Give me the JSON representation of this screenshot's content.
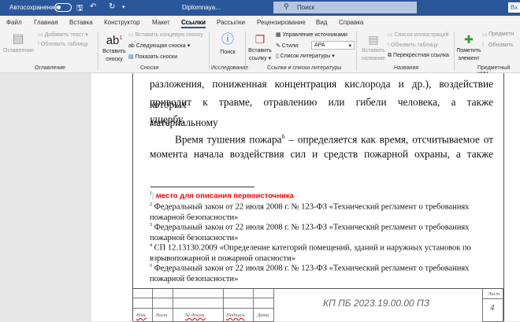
{
  "titlebar": {
    "autosave": "Автосохранение",
    "doc_name": "Diplomnaya...",
    "search_placeholder": "Поиск",
    "signin": "Вх"
  },
  "tabs": [
    "Файл",
    "Главная",
    "Вставка",
    "Конструктор",
    "Макет",
    "Ссылки",
    "Рассылки",
    "Рецензирование",
    "Вид",
    "Справка"
  ],
  "active_tab": "Ссылки",
  "ribbon": {
    "toc": {
      "big": "Оглавление",
      "add_text": "Добавить текст",
      "update_table": "Обновить таблицу",
      "group": "Оглавление"
    },
    "footnotes": {
      "insert_line1": "Вставить",
      "insert_line2": "сноску",
      "insert_endnote": "Вставить концевую сноску",
      "next_footnote": "Следующая сноска",
      "show_notes": "Показать сноски",
      "group": "Сноски"
    },
    "research": {
      "search": "Поиск",
      "group": "Исследование"
    },
    "citations": {
      "insert_line1": "Вставить",
      "insert_line2": "ссылку",
      "manage_sources": "Управление источниками",
      "style_label": "Стили:",
      "style_value": "APA",
      "bibliography": "Список литературы",
      "group": "Ссылки и списки литературы"
    },
    "captions": {
      "insert_line1": "Вставить",
      "insert_line2": "название",
      "table_of_figures": "Список иллюстраций",
      "update_table": "Обновить таблицу",
      "cross_ref": "Перекрестная ссылка",
      "group": "Названия"
    },
    "index": {
      "mark_line1": "Пометить",
      "mark_line2": "элемент",
      "insert_index": "Предметн",
      "update_index": "Обновить",
      "group": "Предметный указ"
    }
  },
  "document": {
    "p1": [
      "разложения, пониженная концентрация кислорода и др.), воздействие которых",
      "приводит к травме, отравлению или гибели человека, а также материальному",
      "ущербу."
    ],
    "p2_start": "Время тушения пожара",
    "p2_sup": "6",
    "p2_rest": " – определяется как время, отсчитываемое от",
    "p2_line2": "момента начала воздействия сил и средств пожарной охраны, а также",
    "footnotes": [
      {
        "num": "1",
        "text": "место для описания первоисточника",
        "highlight": "#e00000"
      },
      {
        "num": "2",
        "text": "Федеральный закон от 22 июля 2008 г. № 123-ФЗ «Технический регламент о требованиях пожарной безопасности»"
      },
      {
        "num": "3",
        "text": "Федеральный закон от 22 июля 2008 г.  № 123-ФЗ «Технический регламент о требованиях пожарной безопасности»"
      },
      {
        "num": "4",
        "text": "СП 12.13130.2009 «Определение категорий помещений, зданий и наружных установок по взрывопожарной и пожарной опасности»"
      },
      {
        "num": "5",
        "text": "Федеральный закон от 22 июля 2008 г. № 123-ФЗ «Технический регламент о требованиях пожарной безопасности»"
      }
    ]
  },
  "stamp": {
    "cols": [
      "Изм.",
      "Лист",
      "№ докум.",
      "Подпись",
      "Дата"
    ],
    "code": "КП ПБ 2023.19.00.00 ПЗ",
    "sheet_label": "Лист",
    "sheet_num": "4"
  }
}
